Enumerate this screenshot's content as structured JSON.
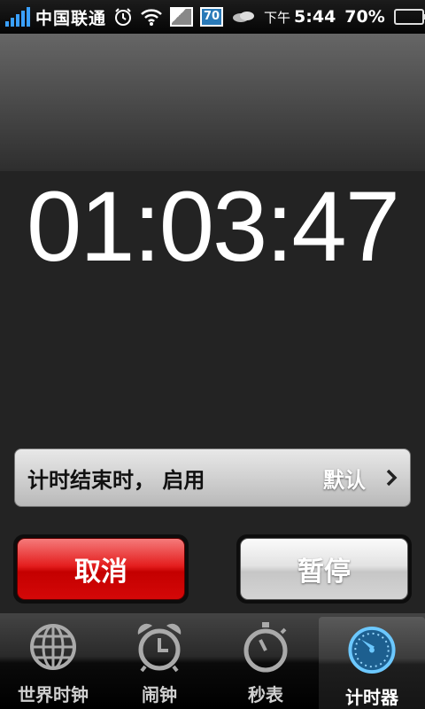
{
  "status_bar": {
    "carrier": "中国联通",
    "badge_number": "70",
    "time_prefix": "下午",
    "time": "5:44",
    "battery_percent": "70%",
    "battery_level": 0.7,
    "icons": [
      "signal-icon",
      "alarm-icon",
      "wifi-icon",
      "image-icon",
      "badge-icon",
      "weather-icon",
      "battery-icon"
    ]
  },
  "timer": {
    "display": "01:03:47"
  },
  "sound_row": {
    "label": "计时结束时， 启用",
    "value": "默认"
  },
  "buttons": {
    "cancel": "取消",
    "pause": "暂停"
  },
  "tabs": [
    {
      "label": "世界时钟",
      "icon": "globe-icon",
      "active": false
    },
    {
      "label": "闹钟",
      "icon": "alarm-clock-icon",
      "active": false
    },
    {
      "label": "秒表",
      "icon": "stopwatch-icon",
      "active": false
    },
    {
      "label": "计时器",
      "icon": "timer-icon",
      "active": true
    }
  ],
  "colors": {
    "cancel_red": "#e41e1e",
    "timer_blue": "#3aa8e8",
    "battery_green": "#3fc63f"
  }
}
